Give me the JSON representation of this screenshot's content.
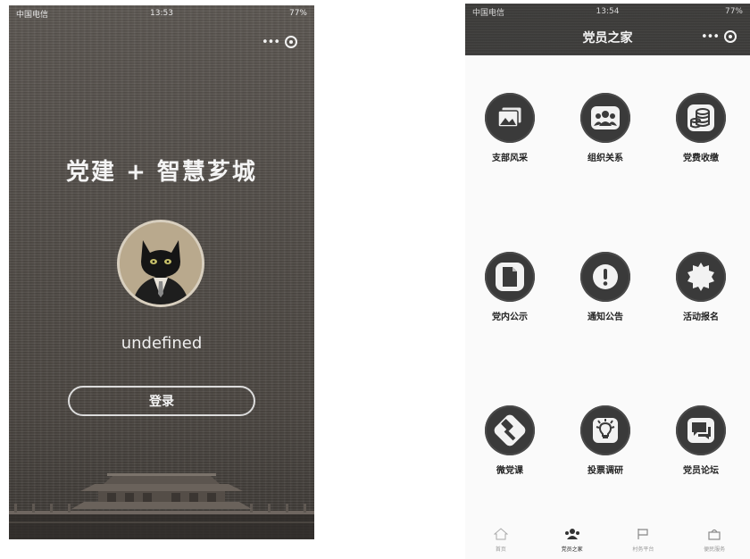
{
  "login_screen": {
    "status": {
      "carrier": "中国电信",
      "time": "13:53",
      "battery": "77%"
    },
    "title": "党建 + 智慧芗城",
    "username": "undefined",
    "login_button": "登录"
  },
  "home_screen": {
    "status": {
      "carrier": "中国电信",
      "time": "13:54",
      "battery": "77%"
    },
    "nav_title": "党员之家",
    "grid": [
      {
        "label": "支部风采",
        "icon": "picture-icon"
      },
      {
        "label": "组织关系",
        "icon": "group-icon"
      },
      {
        "label": "党费收缴",
        "icon": "coins-icon"
      },
      {
        "label": "党内公示",
        "icon": "document-icon"
      },
      {
        "label": "通知公告",
        "icon": "alert-icon"
      },
      {
        "label": "活动报名",
        "icon": "badge-icon"
      },
      {
        "label": "微党课",
        "icon": "hammer-icon"
      },
      {
        "label": "投票调研",
        "icon": "lightbulb-icon"
      },
      {
        "label": "党员论坛",
        "icon": "chat-icon"
      }
    ],
    "tabs": [
      {
        "label": "首页",
        "icon": "home-icon"
      },
      {
        "label": "党员之家",
        "icon": "group-icon"
      },
      {
        "label": "村务平台",
        "icon": "flag-icon"
      },
      {
        "label": "便民服务",
        "icon": "service-icon"
      }
    ]
  }
}
